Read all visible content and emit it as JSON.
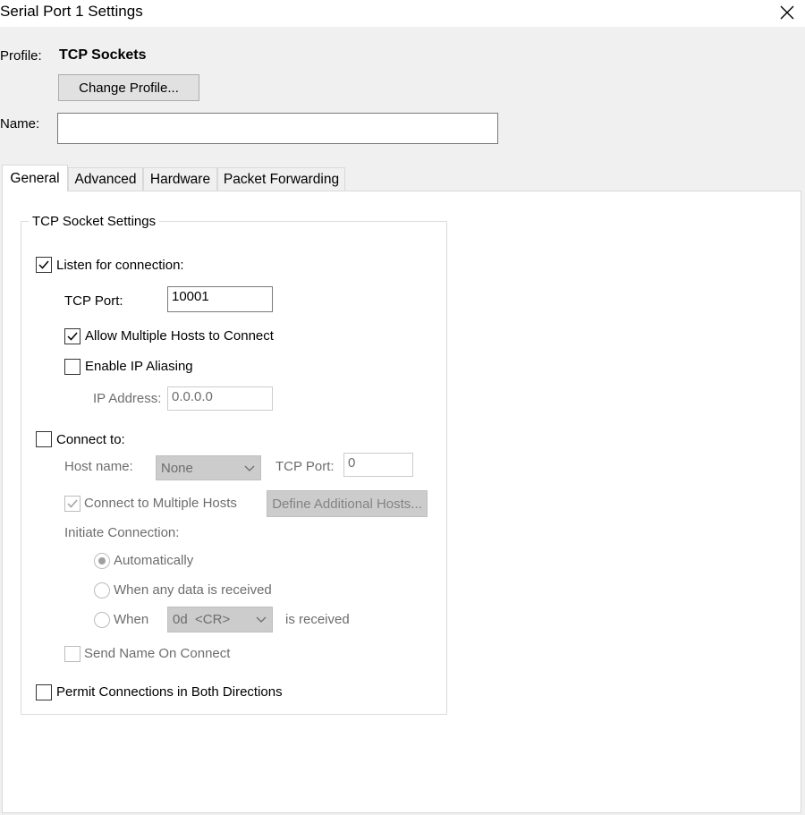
{
  "window": {
    "title": "Serial Port 1 Settings",
    "close_icon": "close-icon"
  },
  "profile": {
    "label": "Profile:",
    "value": "TCP Sockets",
    "change_button": "Change Profile..."
  },
  "name": {
    "label": "Name:",
    "value": ""
  },
  "tabs": [
    {
      "label": "General",
      "active": true
    },
    {
      "label": "Advanced",
      "active": false
    },
    {
      "label": "Hardware",
      "active": false
    },
    {
      "label": "Packet Forwarding",
      "active": false
    }
  ],
  "group": {
    "title": "TCP Socket Settings",
    "listen": {
      "label": "Listen for connection:",
      "checked": true
    },
    "tcp_port": {
      "label": "TCP Port:",
      "value": "10001"
    },
    "allow_multiple": {
      "label": "Allow Multiple Hosts to Connect",
      "checked": true
    },
    "ip_aliasing": {
      "label": "Enable IP Aliasing",
      "checked": false
    },
    "ip_address": {
      "label": "IP Address:",
      "value": "0.0.0.0"
    },
    "connect_to": {
      "label": "Connect to:",
      "checked": false
    },
    "host_name": {
      "label": "Host name:",
      "value": "None"
    },
    "connect_tcp_port": {
      "label": "TCP Port:",
      "value": "0"
    },
    "connect_multiple": {
      "label": "Connect to Multiple Hosts",
      "checked": true
    },
    "define_hosts_button": "Define Additional Hosts...",
    "initiate": {
      "label": "Initiate Connection:",
      "options": [
        "Automatically",
        "When any data is received",
        "When"
      ],
      "selected": "Automatically",
      "when_value": "0d  <CR>",
      "when_suffix": "is received"
    },
    "send_name": {
      "label": "Send Name On Connect",
      "checked": false
    },
    "permit_both": {
      "label": "Permit Connections in Both Directions",
      "checked": false
    }
  }
}
